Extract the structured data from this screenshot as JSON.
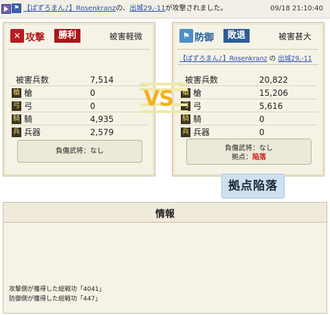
{
  "topbar": {
    "player_link": "【ぱずろまん♪】",
    "target_name": "Rosenkranz",
    "mid1": "の、",
    "location": "出城29,-11",
    "message_tail": "が攻撃されました。",
    "timestamp": "09/18 21:10:40"
  },
  "attack": {
    "badge_icon": "✕",
    "title": "攻撃",
    "result": "勝利",
    "damage_level": "被害軽微",
    "losses_label": "被害兵数",
    "losses_value": "7,514",
    "units": [
      {
        "icon": "spear-icon",
        "glyph": "槍",
        "label": "槍",
        "value": "0"
      },
      {
        "icon": "bow-icon",
        "glyph": "弓",
        "label": "弓",
        "value": "0"
      },
      {
        "icon": "horse-icon",
        "glyph": "騎",
        "label": "騎",
        "value": "4,935"
      },
      {
        "icon": "weapon-icon",
        "glyph": "兵",
        "label": "兵器",
        "value": "2,579"
      }
    ],
    "casualty": "負傷武将：なし"
  },
  "defense": {
    "badge_icon": "⚑",
    "title": "防御",
    "result": "敗退",
    "damage_level": "被害甚大",
    "player_link": "【ぱずろまん♪】",
    "target_name": "Rosenkranz",
    "no": "の",
    "location": "出城29,-11",
    "losses_label": "被害兵数",
    "losses_value": "20,822",
    "units": [
      {
        "icon": "spear-icon",
        "glyph": "槍",
        "label": "槍",
        "value": "15,206"
      },
      {
        "icon": "bow-icon",
        "glyph": "弓",
        "label": "弓",
        "value": "5,616"
      },
      {
        "icon": "horse-icon",
        "glyph": "騎",
        "label": "騎",
        "value": "0"
      },
      {
        "icon": "weapon-icon",
        "glyph": "兵",
        "label": "兵器",
        "value": "0"
      }
    ],
    "casualty": "負傷武将：なし",
    "stronghold_label": "拠点：",
    "stronghold_status": "陥落"
  },
  "vs_text": "VS",
  "fallen_stamp": "拠点陥落",
  "info": {
    "title": "情報",
    "lines": [
      "攻撃側が獲得した総戦功「4041」",
      "防御側が獲得した総戦功「447」"
    ]
  },
  "colors": {
    "attack_red": "#b61d22",
    "defense_blue": "#2e5d94",
    "panel_bg": "#f5f3e6",
    "vs_gold": "#f2b21a",
    "fallen_red": "#d21b1b"
  }
}
